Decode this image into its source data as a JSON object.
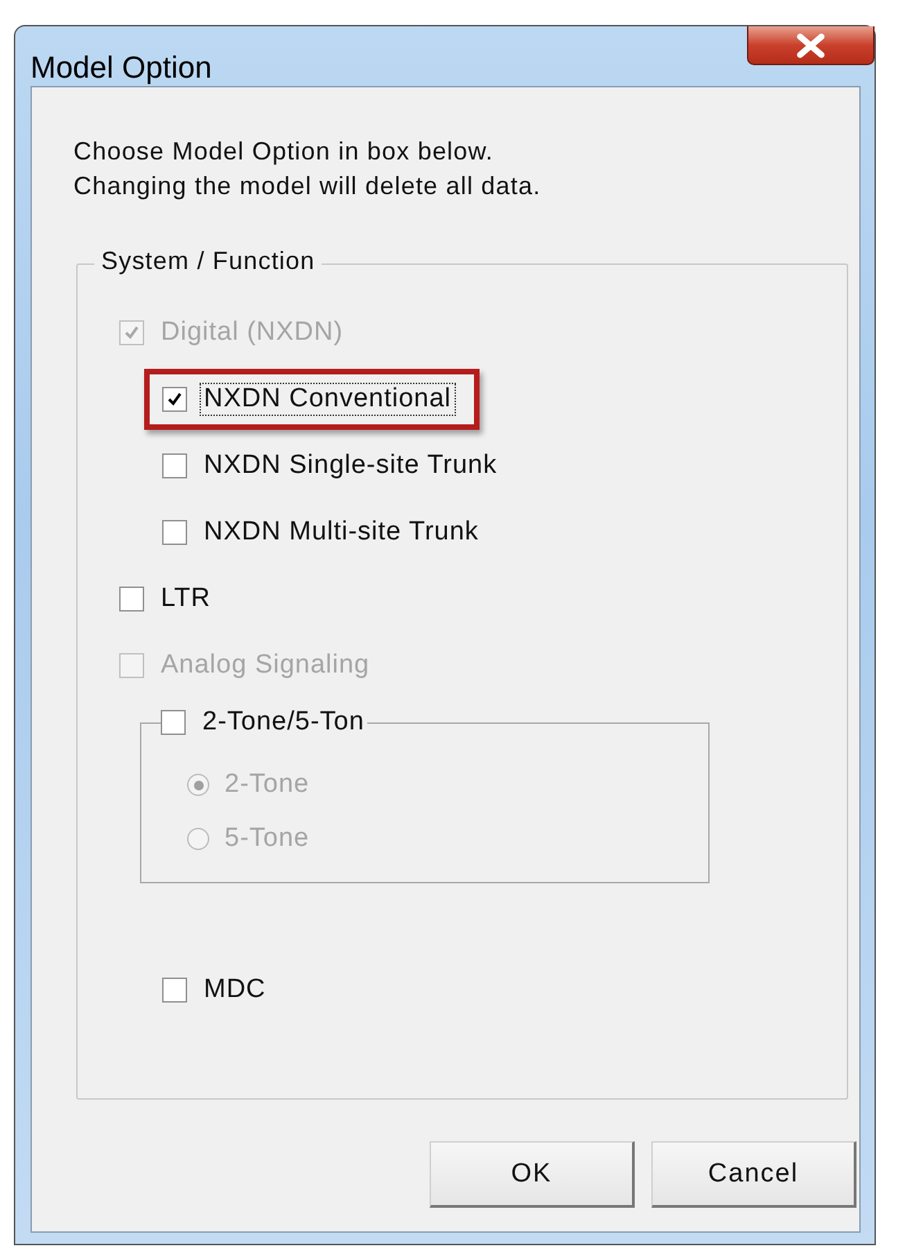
{
  "window": {
    "title": "Model Option"
  },
  "intro": [
    "Choose Model Option in box below.",
    "Changing the model will delete all data."
  ],
  "group": {
    "title": "System / Function",
    "options": [
      {
        "kind": "checkbox",
        "label": "Digital (NXDN)",
        "checked": true,
        "disabled": true,
        "children": [
          {
            "kind": "checkbox",
            "label": "NXDN Conventional",
            "checked": true,
            "disabled": false,
            "focused": true,
            "highlighted": true
          },
          {
            "kind": "checkbox",
            "label": "NXDN Single-site Trunk",
            "checked": false,
            "disabled": false
          },
          {
            "kind": "checkbox",
            "label": "NXDN Multi-site Trunk",
            "checked": false,
            "disabled": false
          }
        ]
      },
      {
        "kind": "checkbox",
        "label": "LTR",
        "checked": false,
        "disabled": false
      },
      {
        "kind": "checkbox",
        "label": "Analog Signaling",
        "checked": false,
        "disabled": true,
        "children": [
          {
            "kind": "group",
            "label": "2-Tone/5-Ton",
            "checked": false,
            "disabled": false,
            "children": [
              {
                "kind": "radio",
                "label": "2-Tone",
                "selected": true,
                "disabled": true
              },
              {
                "kind": "radio",
                "label": "5-Tone",
                "selected": false,
                "disabled": true
              }
            ]
          },
          {
            "kind": "checkbox",
            "label": "MDC",
            "checked": false,
            "disabled": false
          }
        ]
      }
    ]
  },
  "buttons": [
    {
      "label": "OK"
    },
    {
      "label": "Cancel"
    }
  ]
}
